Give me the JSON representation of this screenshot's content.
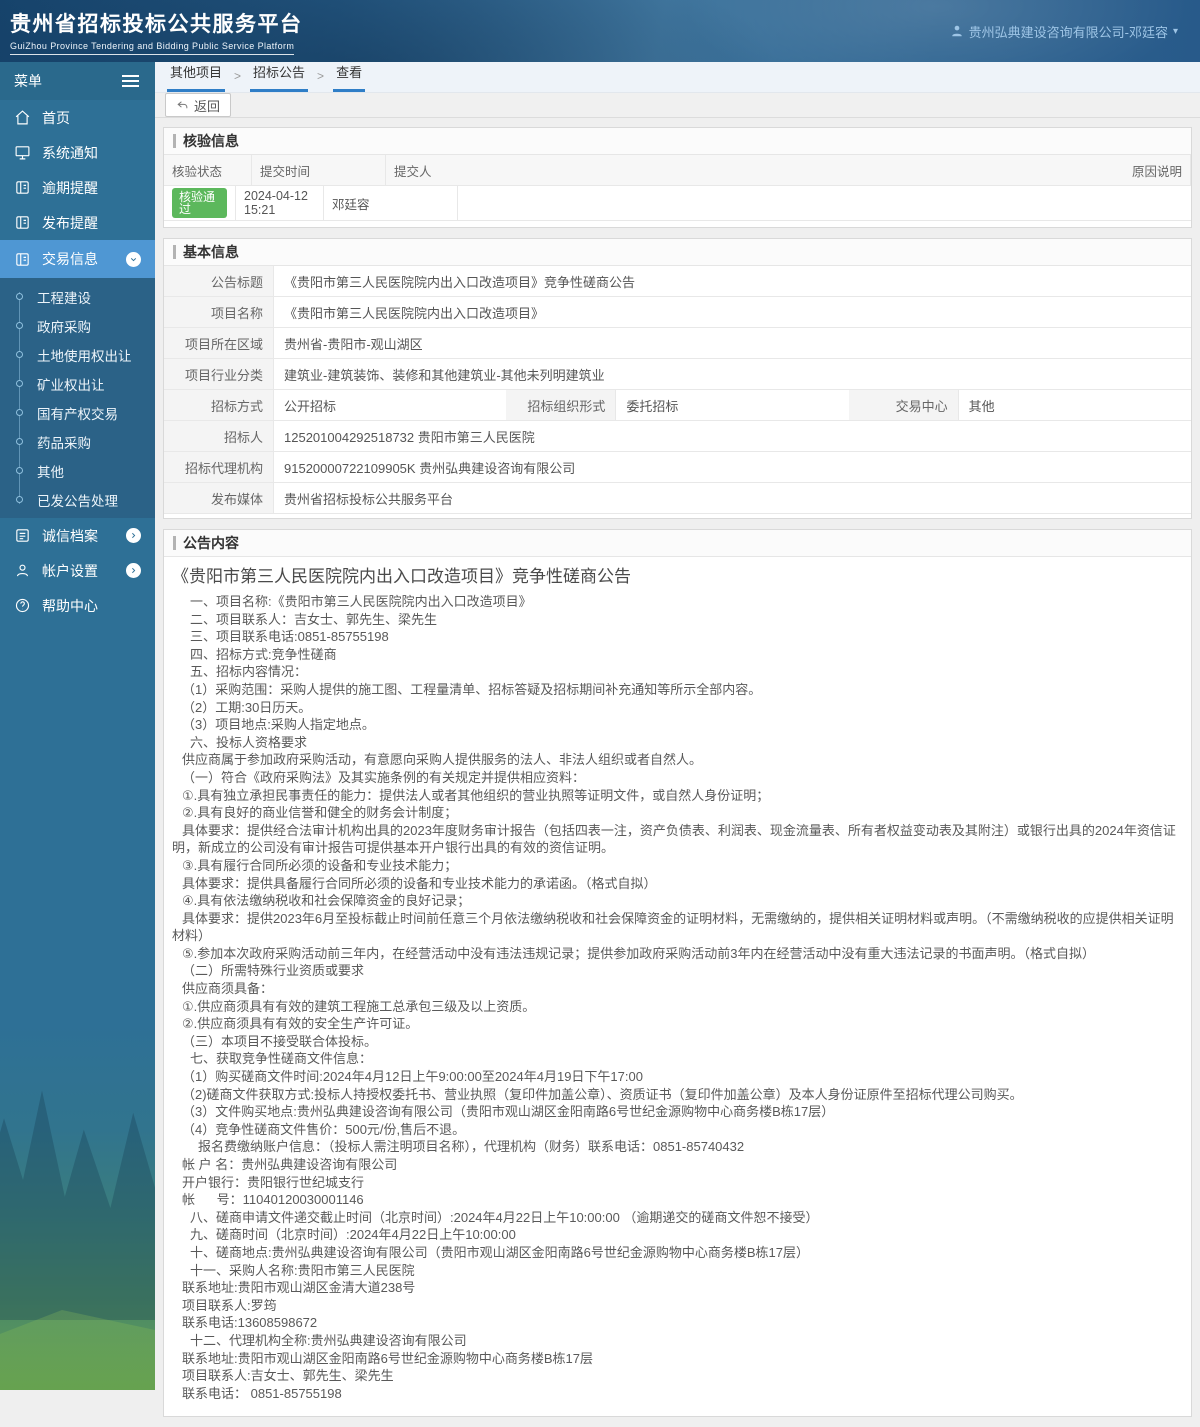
{
  "header": {
    "title": "贵州省招标投标公共服务平台",
    "subtitle": "GuiZhou Province Tendering and Bidding Public Service Platform",
    "user": "贵州弘典建设咨询有限公司-邓廷容"
  },
  "icons": {
    "caret_down": "▾",
    "breadcrumb_separator": ">"
  },
  "colors": {
    "accent_blue": "#2f7ec7",
    "sidebar_blue": "#2e7096",
    "active_item_blue": "#4f97d3",
    "success_green": "#5cb85c"
  },
  "sidebar": {
    "menu_label": "菜单",
    "items": [
      {
        "label": "首页"
      },
      {
        "label": "系统通知"
      },
      {
        "label": "逾期提醒"
      },
      {
        "label": "发布提醒"
      },
      {
        "label": "交易信息"
      }
    ],
    "submenu": [
      "工程建设",
      "政府采购",
      "土地使用权出让",
      "矿业权出让",
      "国有产权交易",
      "药品采购",
      "其他",
      "已发公告处理"
    ],
    "bottom_items": {
      "credit": "诚信档案",
      "account": "帐户设置",
      "help": "帮助中心"
    }
  },
  "breadcrumb": [
    "其他项目",
    "招标公告",
    "查看"
  ],
  "toolbar": {
    "back_label": "返回"
  },
  "verify": {
    "section_title": "核验信息",
    "columns": [
      "核验状态",
      "提交时间",
      "提交人",
      "原因说明"
    ],
    "row": {
      "status": "核验通过",
      "time": "2024-04-12 15:21",
      "submitter": "邓廷容",
      "reason": ""
    }
  },
  "basic": {
    "section_title": "基本信息",
    "fields": {
      "announce_title_label": "公告标题",
      "announce_title": "《贵阳市第三人民医院院内出入口改造项目》竞争性磋商公告",
      "project_name_label": "项目名称",
      "project_name": "《贵阳市第三人民医院院内出入口改造项目》",
      "region_label": "项目所在区域",
      "region": "贵州省-贵阳市-观山湖区",
      "industry_label": "项目行业分类",
      "industry": "建筑业-建筑装饰、装修和其他建筑业-其他未列明建筑业",
      "method_label": "招标方式",
      "method": "公开招标",
      "org_form_label": "招标组织形式",
      "org_form": "委托招标",
      "center_label": "交易中心",
      "center": "其他",
      "tenderee_label": "招标人",
      "tenderee": "125201004292518732 贵阳市第三人民医院",
      "agency_label": "招标代理机构",
      "agency": "91520000722109905K 贵州弘典建设咨询有限公司",
      "media_label": "发布媒体",
      "media": "贵州省招标投标公共服务平台"
    }
  },
  "content": {
    "section_title": "公告内容",
    "title": "《贵阳市第三人民医院院内出入口改造项目》竞争性磋商公告",
    "lines": [
      {
        "t": "一、项目名称:《贵阳市第三人民医院院内出入口改造项目》",
        "ind": "ind2"
      },
      {
        "t": "二、项目联系人：吉女士、郭先生、梁先生",
        "ind": "ind2"
      },
      {
        "t": "三、项目联系电话:0851-85755198",
        "ind": "ind2"
      },
      {
        "t": "四、招标方式:竞争性磋商",
        "ind": "ind2"
      },
      {
        "t": "五、招标内容情况：",
        "ind": "ind2"
      },
      {
        "t": "（1）采购范围：采购人提供的施工图、工程量清单、招标答疑及招标期间补充通知等所示全部内容。",
        "ind": "ind1"
      },
      {
        "t": "（2）工期:30日历天。",
        "ind": "ind1"
      },
      {
        "t": "（3）项目地点:采购人指定地点。",
        "ind": "ind1"
      },
      {
        "t": "六、投标人资格要求",
        "ind": "ind2"
      },
      {
        "t": "供应商属于参加政府采购活动，有意愿向采购人提供服务的法人、非法人组织或者自然人。",
        "ind": "ind1"
      },
      {
        "t": "（一）符合《政府采购法》及其实施条例的有关规定并提供相应资料：",
        "ind": "ind1"
      },
      {
        "t": "①.具有独立承担民事责任的能力：提供法人或者其他组织的营业执照等证明文件，或自然人身份证明；",
        "ind": "ind1"
      },
      {
        "t": "②.具有良好的商业信誉和健全的财务会计制度；",
        "ind": "ind1"
      },
      {
        "t": "具体要求：提供经合法审计机构出具的2023年度财务审计报告（包括四表一注，资产负债表、利润表、现金流量表、所有者权益变动表及其附注）或银行出具的2024年资信证明，新成立的公司没有审计报告可提供基本开户银行出具的有效的资信证明。",
        "ind": "ind1"
      },
      {
        "t": "③.具有履行合同所必须的设备和专业技术能力；",
        "ind": "ind1"
      },
      {
        "t": "具体要求：提供具备履行合同所必须的设备和专业技术能力的承诺函。（格式自拟）",
        "ind": "ind1"
      },
      {
        "t": "④.具有依法缴纳税收和社会保障资金的良好记录；",
        "ind": "ind1"
      },
      {
        "t": "具体要求：提供2023年6月至投标截止时间前任意三个月依法缴纳税收和社会保障资金的证明材料，无需缴纳的，提供相关证明材料或声明。（不需缴纳税收的应提供相关证明材料）",
        "ind": "ind1"
      },
      {
        "t": "⑤.参加本次政府采购活动前三年内，在经营活动中没有违法违规记录；提供参加政府采购活动前3年内在经营活动中没有重大违法记录的书面声明。（格式自拟）",
        "ind": "ind1"
      },
      {
        "t": "（二）所需特殊行业资质或要求",
        "ind": "ind1"
      },
      {
        "t": "供应商须具备：",
        "ind": "ind1"
      },
      {
        "t": "①.供应商须具有有效的建筑工程施工总承包三级及以上资质。",
        "ind": "ind1"
      },
      {
        "t": "②.供应商须具有有效的安全生产许可证。",
        "ind": "ind1"
      },
      {
        "t": "（三）本项目不接受联合体投标。",
        "ind": "ind1"
      },
      {
        "t": "七、获取竞争性磋商文件信息：",
        "ind": "ind2"
      },
      {
        "t": "（1）购买磋商文件时间:2024年4月12日上午9:00:00至2024年4月19日下午17:00",
        "ind": "ind1"
      },
      {
        "t": "（2)磋商文件获取方式:投标人持授权委托书、营业执照（复印件加盖公章）、资质证书（复印件加盖公章）及本人身份证原件至招标代理公司购买。",
        "ind": "ind1"
      },
      {
        "t": "（3）文件购买地点:贵州弘典建设咨询有限公司（贵阳市观山湖区金阳南路6号世纪金源购物中心商务楼B栋17层）",
        "ind": "ind1"
      },
      {
        "t": "（4）竞争性磋商文件售价：500元/份,售后不退。",
        "ind": "ind1"
      },
      {
        "t": "报名费缴纳账户信息：（投标人需注明项目名称），代理机构（财务）联系电话：0851-85740432",
        "ind": "ind3"
      },
      {
        "t": "帐 户 名：贵州弘典建设咨询有限公司",
        "ind": "ind1"
      },
      {
        "t": "开户银行：贵阳银行世纪城支行",
        "ind": "ind1"
      },
      {
        "t": "帐      号：11040120030001146",
        "ind": "ind1"
      },
      {
        "t": "八、磋商申请文件递交截止时间（北京时间）:2024年4月22日上午10:00:00 （逾期递交的磋商文件恕不接受）",
        "ind": "ind2"
      },
      {
        "t": "九、磋商时间（北京时间）:2024年4月22日上午10:00:00",
        "ind": "ind2"
      },
      {
        "t": "十、磋商地点:贵州弘典建设咨询有限公司（贵阳市观山湖区金阳南路6号世纪金源购物中心商务楼B栋17层）",
        "ind": "ind2"
      },
      {
        "t": "十一、采购人名称:贵阳市第三人民医院",
        "ind": "ind2"
      },
      {
        "t": "联系地址:贵阳市观山湖区金清大道238号",
        "ind": "ind1"
      },
      {
        "t": "项目联系人:罗筠",
        "ind": "ind1"
      },
      {
        "t": "联系电话:13608598672",
        "ind": "ind1"
      },
      {
        "t": "十二、代理机构全称:贵州弘典建设咨询有限公司",
        "ind": "ind2"
      },
      {
        "t": "联系地址:贵阳市观山湖区金阳南路6号世纪金源购物中心商务楼B栋17层",
        "ind": "ind1"
      },
      {
        "t": "项目联系人:吉女士、郭先生、梁先生",
        "ind": "ind1"
      },
      {
        "t": "联系电话： 0851-85755198",
        "ind": "ind1"
      }
    ]
  }
}
